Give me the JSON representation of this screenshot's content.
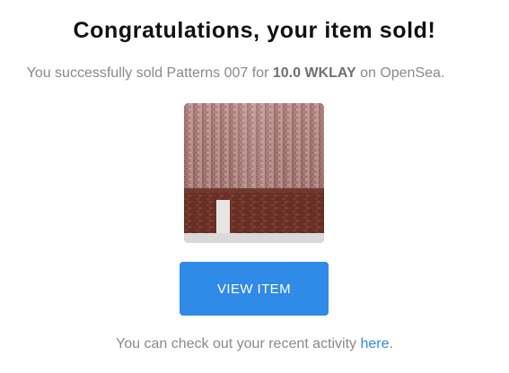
{
  "email": {
    "title": "Congratulations, your item sold!",
    "subtitle": {
      "prefix": "You successfully sold Patterns 007 for ",
      "price": "10.0 WKLAY",
      "suffix": " on OpenSea."
    },
    "item_image": {
      "subject": "brick wall photograph"
    },
    "view_button_label": "VIEW ITEM",
    "footer": {
      "prefix": "You can check out your recent activity ",
      "link_text": "here",
      "suffix": "."
    }
  },
  "colors": {
    "accent": "#2f8ae8",
    "title": "#111111",
    "muted_text": "#8a8a8a"
  }
}
